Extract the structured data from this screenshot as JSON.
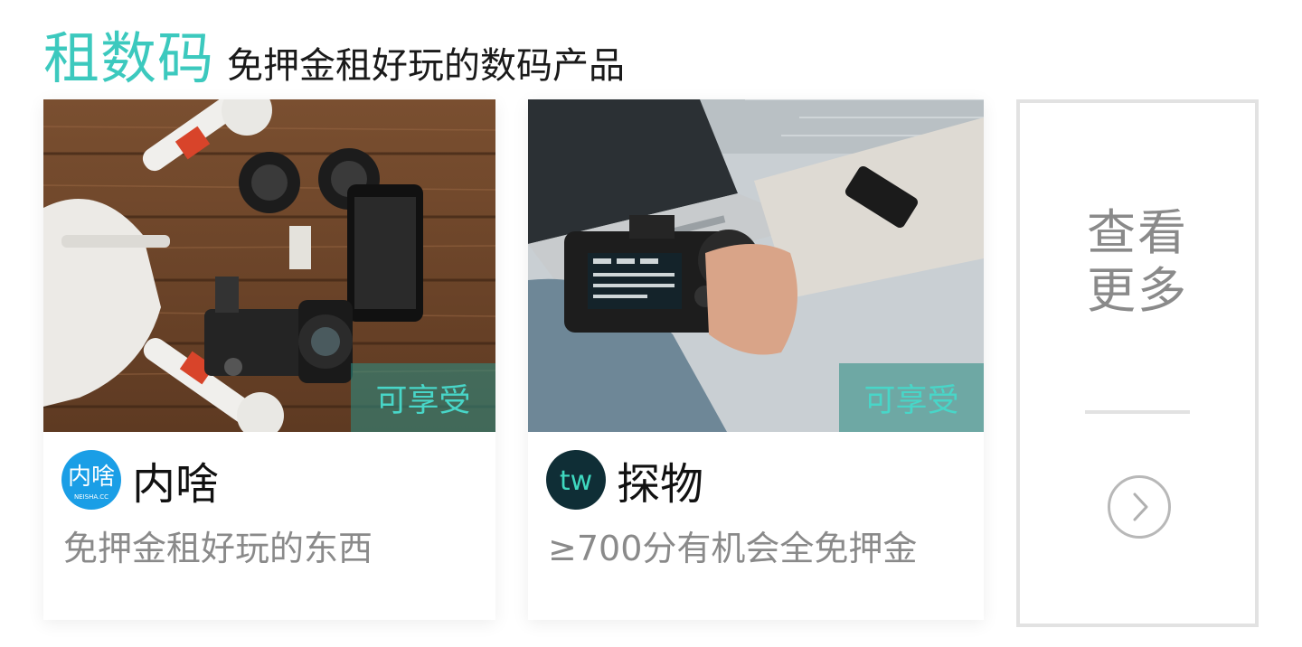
{
  "header": {
    "title": "租数码",
    "subtitle": "免押金租好玩的数码产品"
  },
  "cards": [
    {
      "badge": "可享受",
      "brand": "内啥",
      "logo_text": "NEISHA.CC",
      "desc": "免押金租好玩的东西"
    },
    {
      "badge": "可享受",
      "brand": "探物",
      "logo_text": "tw",
      "desc": "≥700分有机会全免押金"
    }
  ],
  "more": {
    "line1": "查看",
    "line2": "更多"
  },
  "colors": {
    "accent": "#3cc9be",
    "badge_text": "#48d6c8",
    "neisha_logo": "#1a9ee6",
    "tanwu_logo": "#0f2e36"
  },
  "icons": {
    "more_arrow": "chevron-right-circle-icon"
  }
}
